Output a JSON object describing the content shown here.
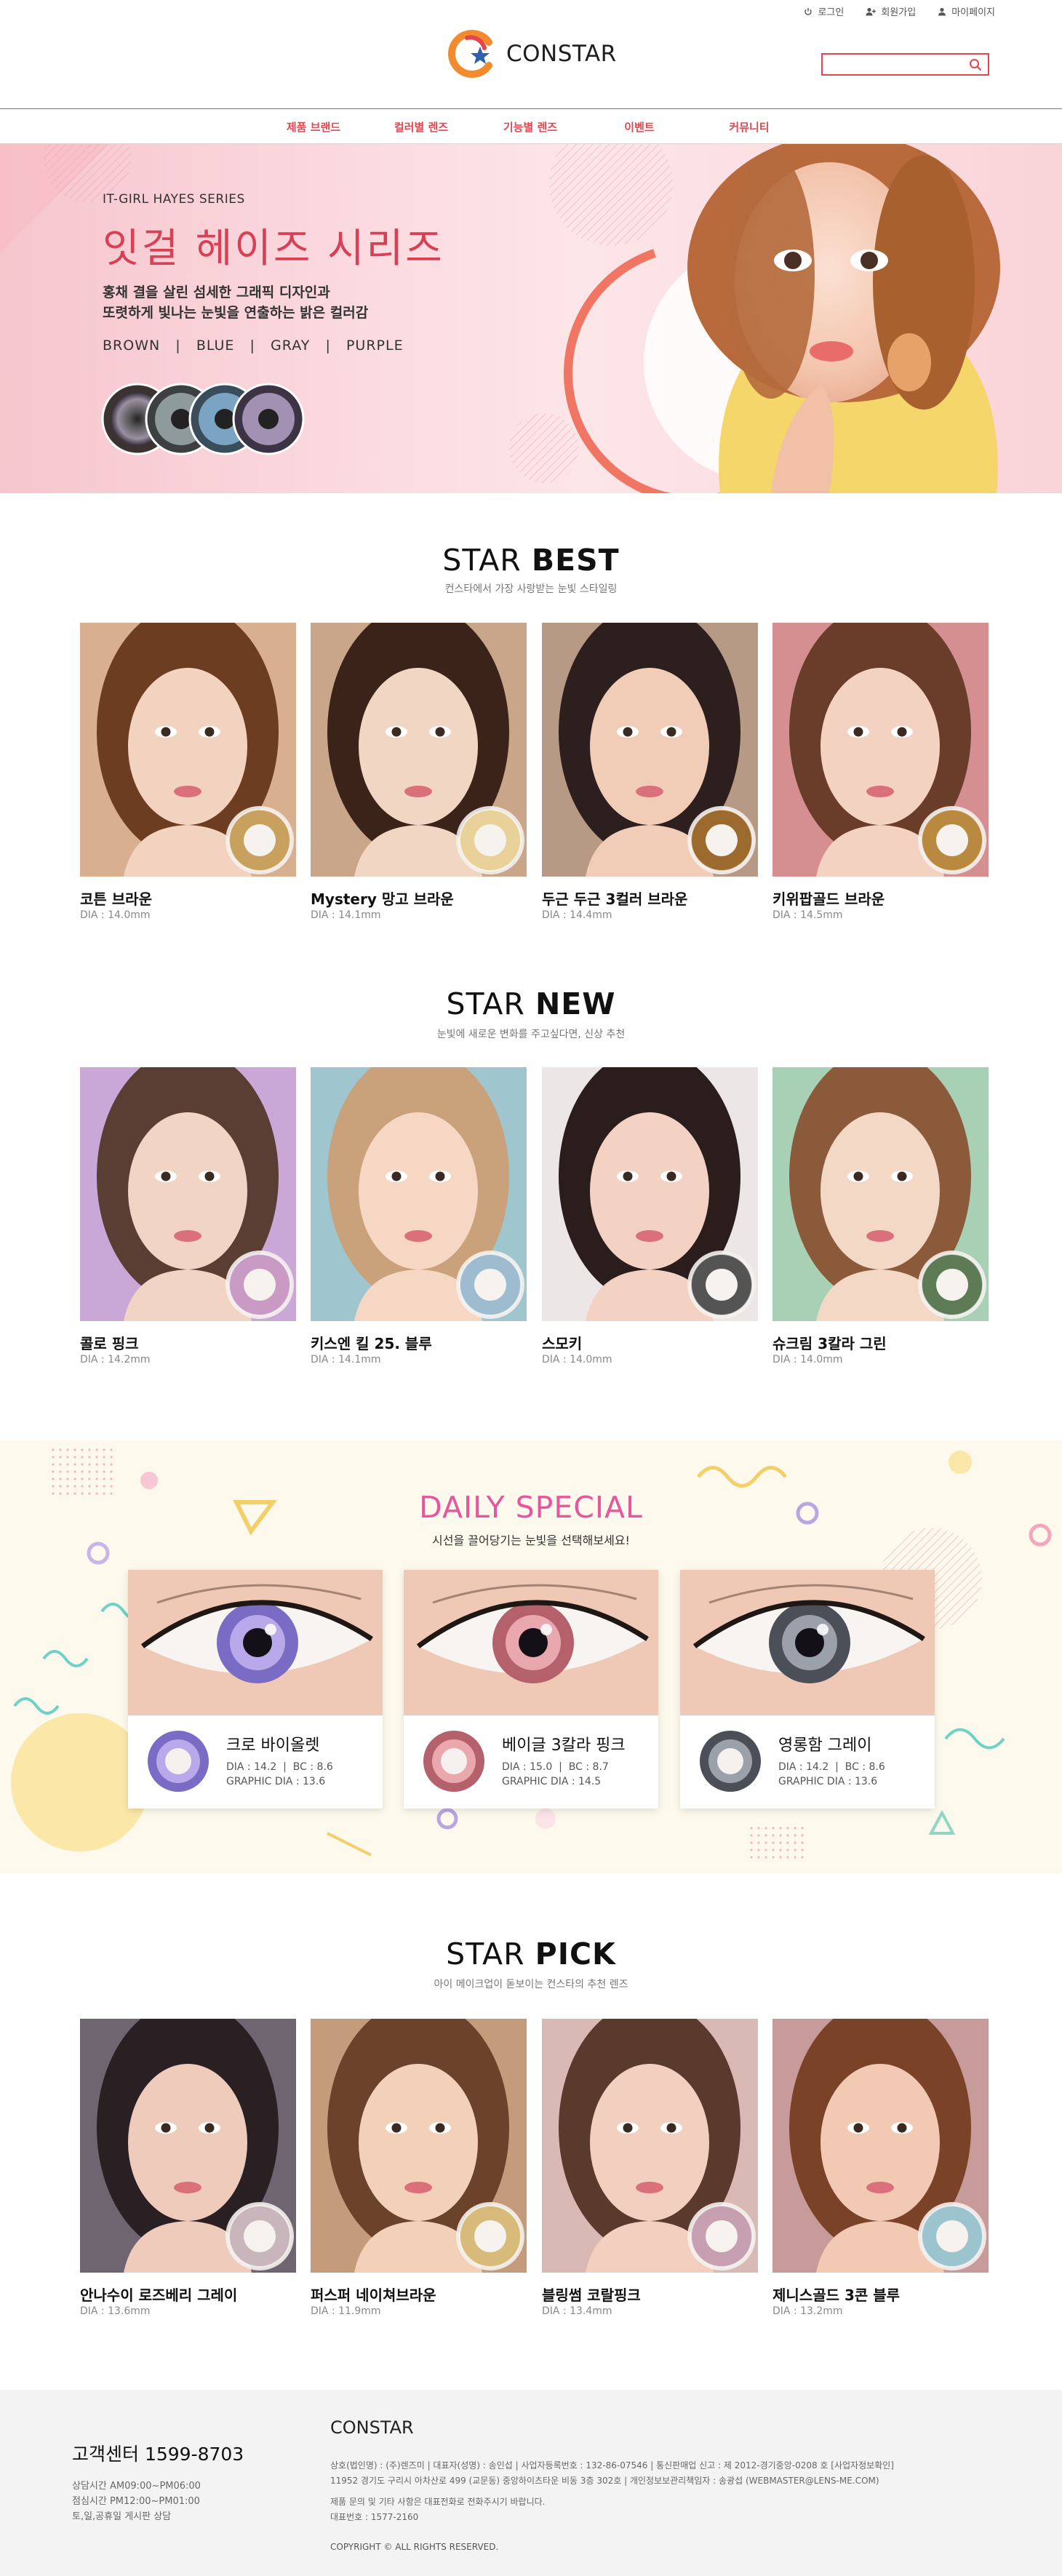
{
  "header": {
    "links": [
      {
        "label": "로그인",
        "icon": "power-icon"
      },
      {
        "label": "회원가입",
        "icon": "add-user-icon"
      },
      {
        "label": "마이페이지",
        "icon": "user-icon"
      }
    ],
    "logo_text": "CONSTAR",
    "search": {
      "placeholder": "",
      "value": ""
    },
    "colors": {
      "accent": "#e5454f",
      "brand_orange": "#f28a2e",
      "brand_blue": "#2f5fae"
    }
  },
  "nav": {
    "items": [
      "제품 브랜드",
      "컬러별 렌즈",
      "기능별 렌즈",
      "이벤트",
      "커뮤니티"
    ]
  },
  "hero": {
    "subtitle": "IT-GIRL HAYES SERIES",
    "title": "잇걸 헤이즈 시리즈",
    "desc_line1": "홍채 결을 살린 섬세한 그래픽 디자인과",
    "desc_line2": "또렷하게 빛나는 눈빛을 연출하는 밝은 컬러감",
    "colors_text": "BROWN   |   BLUE   |   GRAY   |   PURPLE"
  },
  "best": {
    "title_light": "STAR ",
    "title_bold": "BEST",
    "subtitle": "컨스타에서 가장 사랑받는 눈빛 스타일링",
    "products": [
      {
        "name": "코튼 브라운",
        "dia": "DIA : 14.0mm"
      },
      {
        "name": "Mystery 망고 브라운",
        "dia": "DIA : 14.1mm"
      },
      {
        "name": "두근 두근 3컬러 브라운",
        "dia": "DIA : 14.4mm"
      },
      {
        "name": "키위팝골드 브라운",
        "dia": "DIA : 14.5mm"
      }
    ]
  },
  "new": {
    "title_light": "STAR ",
    "title_bold": "NEW",
    "subtitle": "눈빛에 새로운 변화를 주고싶다면, 신상 추천",
    "products": [
      {
        "name": "콜로 핑크",
        "dia": "DIA : 14.2mm"
      },
      {
        "name": "키스엔 킬 25. 블루",
        "dia": "DIA : 14.1mm"
      },
      {
        "name": "스모키",
        "dia": "DIA : 14.0mm"
      },
      {
        "name": "슈크림 3칼라 그린",
        "dia": "DIA : 14.0mm"
      }
    ]
  },
  "daily": {
    "title": "DAILY SPECIAL",
    "subtitle": "시선을 끌어당기는 눈빛을 선택해보세요!",
    "items": [
      {
        "name": "크로 바이올렛",
        "spec1": "DIA : 14.2  |  BC : 8.6",
        "spec2": "GRAPHIC DIA : 13.6"
      },
      {
        "name": "베이글 3칼라 핑크",
        "spec1": "DIA : 15.0  |  BC : 8.7",
        "spec2": "GRAPHIC DIA : 14.5"
      },
      {
        "name": "영롱함 그레이",
        "spec1": "DIA : 14.2  |  BC : 8.6",
        "spec2": "GRAPHIC DIA : 13.6"
      }
    ]
  },
  "pick": {
    "title_light": "STAR ",
    "title_bold": "PICK",
    "subtitle": "아이 메이크업이 돋보이는 컨스타의 추천 렌즈",
    "products": [
      {
        "name": "안나수이 로즈베리 그레이",
        "dia": "DIA : 13.6mm"
      },
      {
        "name": "퍼스퍼 네이쳐브라운",
        "dia": "DIA : 11.9mm"
      },
      {
        "name": "블링썸 코랄핑크",
        "dia": "DIA : 13.4mm"
      },
      {
        "name": "제니스골드 3콘 블루",
        "dia": "DIA : 13.2mm"
      }
    ]
  },
  "footer": {
    "cs_title": "고객센터 1599-8703",
    "hours1": "상담시간 AM09:00~PM06:00",
    "hours2": "점심시간 PM12:00~PM01:00",
    "hours3": "토,일,공휴일 게시판 상담",
    "brand": "CONSTAR",
    "info1": "상호(법인명) : (주)렌즈미  |  대표자(성명) : 송인섭  |  사업자등록번호 : 132-86-07546  |  통신판매업 신고 : 제 2012-경기중앙-0208 호 [사업자정보확인]",
    "info2": "11952 경기도 구리시 아차산로 499 (교문동) 중앙하이츠타운 비동 3층 302호  |  개인정보보관리책임자 : 송광섭 (WEBMASTER@LENS-ME.COM)",
    "info3": "제품 문의 및 기타 사항은 대표전화로 전화주시기 바랍니다.",
    "info4": "대표번호 : 1577-2160",
    "copyright": "COPYRIGHT © ALL RIGHTS RESERVED."
  }
}
